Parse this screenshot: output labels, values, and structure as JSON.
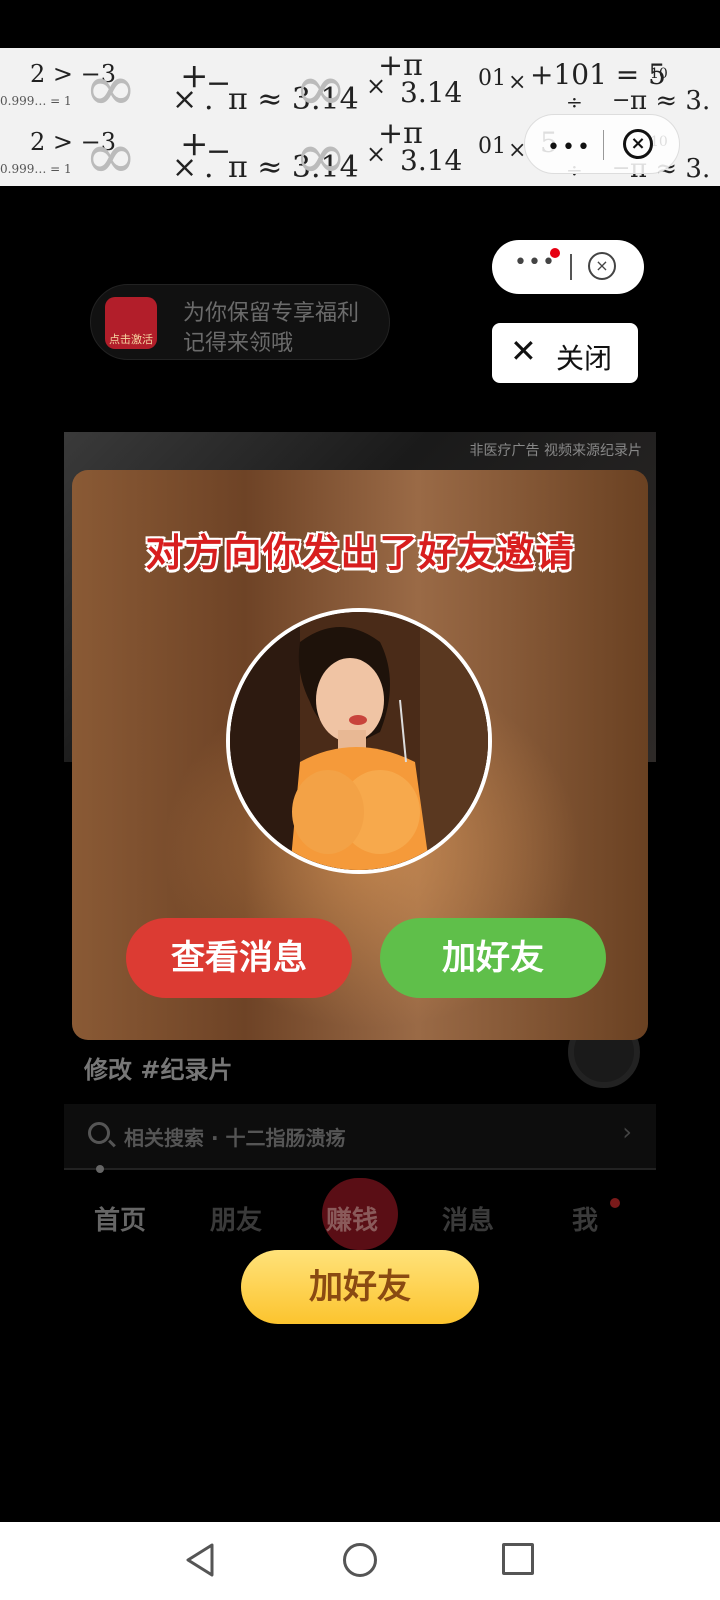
{
  "banner_ad": {
    "row1": [
      "2 > −3",
      "∞",
      "+",
      "−",
      "0.999… = 1",
      "×",
      ".",
      "π ≈ 3.14",
      "∞",
      "+π",
      "×",
      "3.14",
      "01",
      "×",
      "+101 = 5",
      "10",
      "÷",
      "−",
      "π ≈ 3."
    ],
    "row2": [
      "2 > −3",
      "∞",
      "+",
      "−",
      "0.999… = 1",
      "×",
      ".",
      "π ≈ 3.14",
      "∞",
      "+π",
      "×",
      "3.14",
      "01",
      "×",
      "5",
      "10",
      "÷",
      "−",
      "π ≈ 3."
    ],
    "capsule_more": "•••",
    "capsule_close": "×"
  },
  "background_app": {
    "promo_chip": {
      "badge": "点击激活",
      "line1": "为你保留专享福利",
      "line2": "记得来领哦"
    },
    "video_caption": "非医疗广告  视频来源纪录片",
    "caption": "修改 #纪录片",
    "search": {
      "text": "相关搜索 · 十二指肠溃疡",
      "chevron": "›"
    },
    "nav": [
      "首页",
      "朋友",
      "赚钱",
      "消息",
      "我"
    ]
  },
  "overlay": {
    "capsule_more": "•••",
    "capsule_close": "×",
    "close_label": "关闭",
    "close_glyph": "✕"
  },
  "modal": {
    "title": "对方向你发出了好友邀请",
    "view_button": "查看消息",
    "add_button": "加好友"
  },
  "cta_button": "加好友",
  "colors": {
    "modal_title": "#d81e1e",
    "view_button": "#dc3b33",
    "add_button": "#5fbf4a",
    "cta": "#fcc42e"
  }
}
